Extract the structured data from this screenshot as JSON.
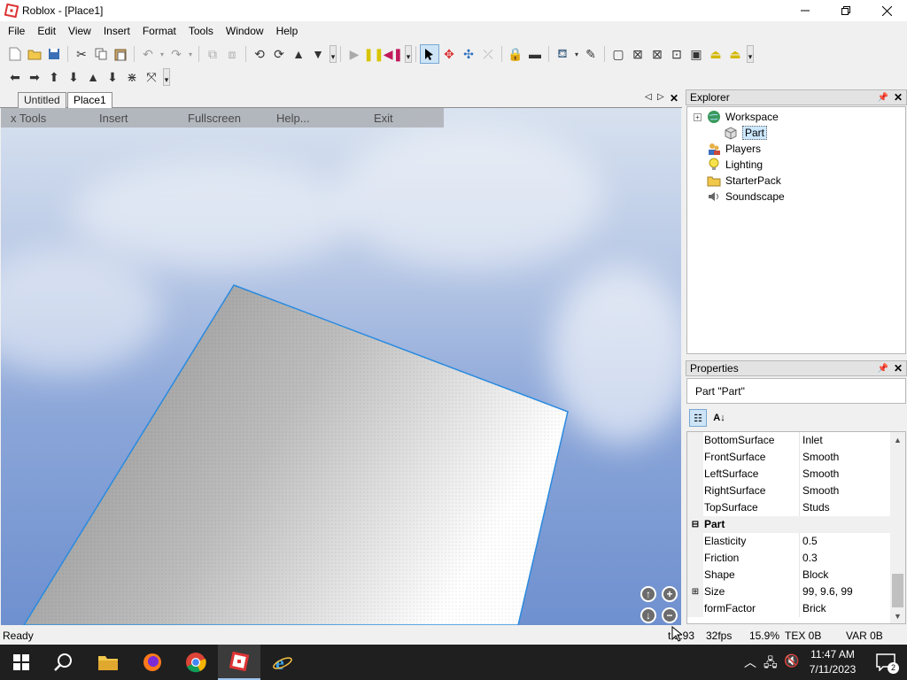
{
  "window": {
    "title": "Roblox - [Place1]"
  },
  "menubar": {
    "items": [
      "File",
      "Edit",
      "View",
      "Insert",
      "Format",
      "Tools",
      "Window",
      "Help"
    ]
  },
  "doc_tabs": {
    "tabs": [
      "Untitled",
      "Place1"
    ],
    "active": "Place1"
  },
  "viewport_menu": {
    "items": [
      "x Tools",
      "Insert",
      "Fullscreen",
      "Help...",
      "Exit"
    ]
  },
  "explorer": {
    "title": "Explorer",
    "items": [
      "Workspace",
      "Part",
      "Players",
      "Lighting",
      "StarterPack",
      "Soundscape"
    ],
    "selected": "Part"
  },
  "properties": {
    "title": "Properties",
    "object_label": "Part \"Part\"",
    "rows": [
      {
        "name": "BottomSurface",
        "value": "Inlet"
      },
      {
        "name": "FrontSurface",
        "value": "Smooth"
      },
      {
        "name": "LeftSurface",
        "value": "Smooth"
      },
      {
        "name": "RightSurface",
        "value": "Smooth"
      },
      {
        "name": "TopSurface",
        "value": "Studs"
      },
      {
        "name": "Part",
        "value": ""
      },
      {
        "name": "Elasticity",
        "value": "0.5"
      },
      {
        "name": "Friction",
        "value": "0.3"
      },
      {
        "name": "Shape",
        "value": "Block"
      },
      {
        "name": "Size",
        "value": "99, 9.6, 99"
      },
      {
        "name": "formFactor",
        "value": "Brick"
      }
    ]
  },
  "statusbar": {
    "left": "Ready",
    "time": "t 9.93",
    "fps": "32fps",
    "percent": "15.9%",
    "tex": "TEX 0B",
    "var": "VAR 0B"
  },
  "taskbar": {
    "time": "11:47 AM",
    "date": "7/11/2023",
    "notifications": "2"
  },
  "colors": {
    "selection_blue": "#1e7ad6",
    "taskbar": "#1f1f1f"
  }
}
